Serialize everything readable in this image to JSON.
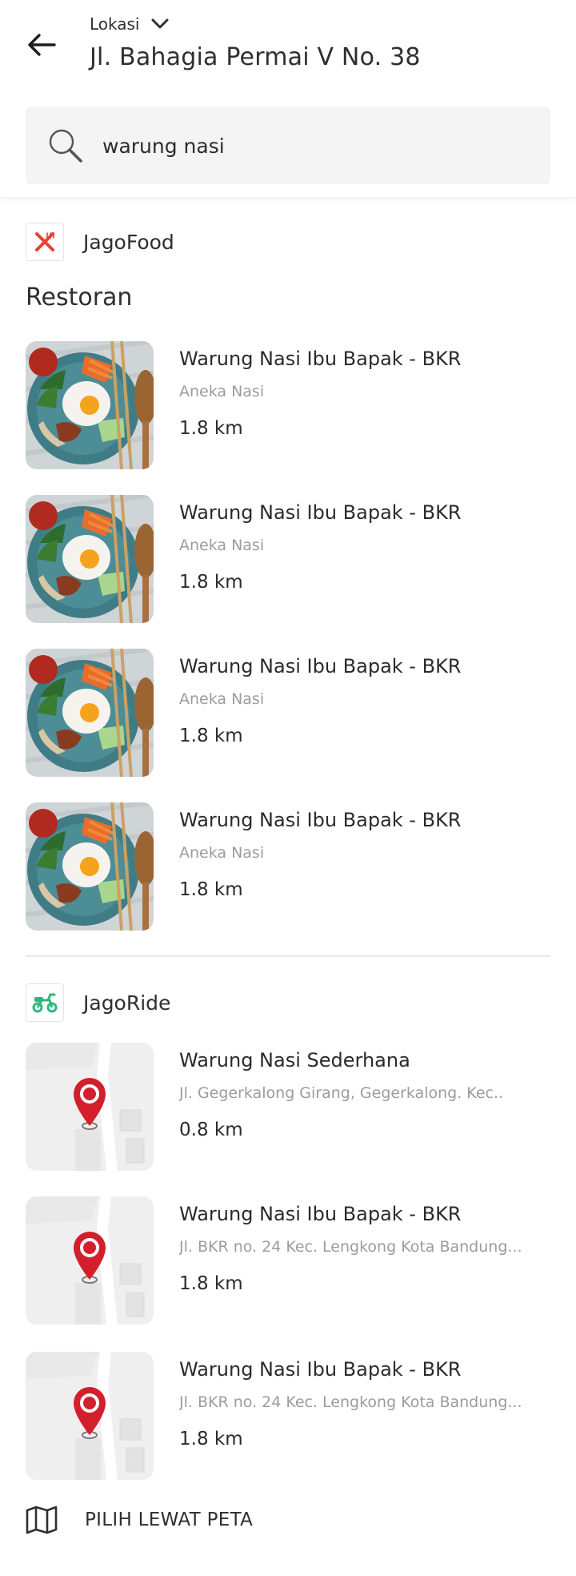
{
  "header": {
    "location_label": "Lokasi",
    "address": "Jl. Bahagia Permai V No. 38"
  },
  "search": {
    "value": "warung nasi"
  },
  "jagofood": {
    "brand": "JagoFood",
    "section_title": "Restoran",
    "accent_color": "#e8412f",
    "items": [
      {
        "name": "Warung Nasi Ibu Bapak - BKR",
        "category": "Aneka Nasi",
        "distance": "1.8 km"
      },
      {
        "name": "Warung Nasi Ibu Bapak - BKR",
        "category": "Aneka Nasi",
        "distance": "1.8 km"
      },
      {
        "name": "Warung Nasi Ibu Bapak - BKR",
        "category": "Aneka Nasi",
        "distance": "1.8 km"
      },
      {
        "name": "Warung Nasi Ibu Bapak - BKR",
        "category": "Aneka Nasi",
        "distance": "1.8 km"
      }
    ]
  },
  "jagoride": {
    "brand": "JagoRide",
    "accent_color": "#2fb87b",
    "pin_color": "#d21f2b",
    "items": [
      {
        "name": "Warung Nasi Sederhana",
        "address": "Jl. Gegerkalong Girang, Gegerkalong. Kec..",
        "distance": "0.8 km"
      },
      {
        "name": "Warung Nasi Ibu Bapak - BKR",
        "address": "Jl. BKR no. 24 Kec. Lengkong Kota Bandung...",
        "distance": "1.8 km"
      },
      {
        "name": "Warung Nasi Ibu Bapak - BKR",
        "address": "Jl. BKR no. 24 Kec. Lengkong Kota Bandung...",
        "distance": "1.8 km"
      }
    ]
  },
  "pick_map": {
    "label": "PILIH LEWAT PETA"
  }
}
